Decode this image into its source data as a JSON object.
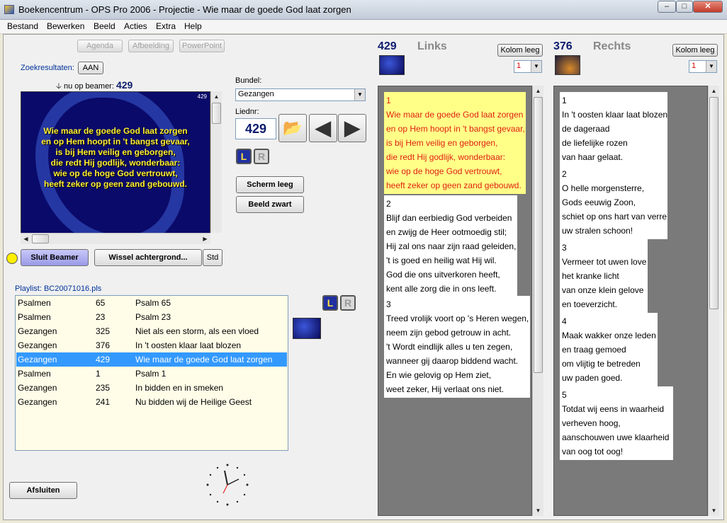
{
  "window": {
    "title": "Boekencentrum - OPS Pro 2006 - Projectie - Wie maar de goede God laat zorgen"
  },
  "menu": [
    "Bestand",
    "Bewerken",
    "Beeld",
    "Acties",
    "Extra",
    "Help"
  ],
  "toolbar": {
    "agenda": "Agenda",
    "afbeelding": "Afbeelding",
    "powerpoint": "PowerPoint"
  },
  "search": {
    "label": "Zoekresultaten:",
    "toggle": "AAN"
  },
  "beamer": {
    "label": "nu op beamer:",
    "current": "429",
    "corner_number": "429",
    "text": [
      "Wie maar de goede God laat zorgen",
      "en op Hem hoopt in 't bangst gevaar,",
      "is bij Hem veilig en geborgen,",
      "die redt Hij godlijk, wonderbaar:",
      "wie op de hoge God vertrouwt,",
      "heeft zeker op geen zand gebouwd."
    ]
  },
  "bundle": {
    "label": "Bundel:",
    "value": "Gezangen"
  },
  "song": {
    "label": "Liednr:",
    "value": "429"
  },
  "screen_buttons": {
    "clear": "Scherm leeg",
    "black": "Beeld zwart"
  },
  "beamer_controls": {
    "close": "Sluit Beamer",
    "background": "Wissel achtergrond...",
    "std": "Std"
  },
  "lr": {
    "left": "L",
    "right": "R"
  },
  "playlist": {
    "label": "Playlist: BC20071016.pls",
    "rows": [
      {
        "book": "Psalmen",
        "num": "65",
        "title": "Psalm 65"
      },
      {
        "book": "Psalmen",
        "num": "23",
        "title": "Psalm 23"
      },
      {
        "book": "Gezangen",
        "num": "325",
        "title": "Niet als een storm, als een vloed"
      },
      {
        "book": "Gezangen",
        "num": "376",
        "title": "In 't oosten klaar laat blozen"
      },
      {
        "book": "Gezangen",
        "num": "429",
        "title": "Wie maar de goede God laat zorgen"
      },
      {
        "book": "Psalmen",
        "num": "1",
        "title": "Psalm 1"
      },
      {
        "book": "Gezangen",
        "num": "235",
        "title": "In bidden en in smeken"
      },
      {
        "book": "Gezangen",
        "num": "241",
        "title": "Nu bidden wij de Heilige Geest"
      }
    ],
    "selected_index": 4
  },
  "exit": "Afsluiten",
  "left_panel": {
    "number": "429",
    "title": "Links",
    "clear": "Kolom leeg",
    "select_value": "1",
    "verses": [
      {
        "n": "1",
        "lines": [
          "Wie maar de goede God laat zorgen",
          "en op Hem hoopt in 't bangst gevaar,",
          "is bij Hem veilig en geborgen,",
          "die redt Hij godlijk, wonderbaar:",
          "wie op de hoge God vertrouwt,",
          "heeft zeker op geen zand gebouwd."
        ]
      },
      {
        "n": "2",
        "lines": [
          "Blijf dan eerbiedig God verbeiden",
          "en zwijg de Heer ootmoedig stil;",
          "Hij zal ons naar zijn raad geleiden,",
          "'t is goed en heilig wat Hij wil.",
          "God die ons uitverkoren heeft,",
          "kent alle zorg die in ons leeft."
        ]
      },
      {
        "n": "3",
        "lines": [
          "Treed vrolijk voort op 's Heren wegen,",
          "neem zijn gebod getrouw in acht.",
          "'t Wordt eindlijk alles u ten zegen,",
          "wanneer gij daarop biddend wacht.",
          "En wie gelovig op Hem ziet,",
          "weet zeker, Hij verlaat ons niet."
        ]
      }
    ]
  },
  "right_panel": {
    "number": "376",
    "title": "Rechts",
    "clear": "Kolom leeg",
    "select_value": "1",
    "verses": [
      {
        "n": "1",
        "lines": [
          "In 't oosten klaar laat blozen",
          "de dageraad",
          "de liefelijke rozen",
          "van haar gelaat."
        ]
      },
      {
        "n": "2",
        "lines": [
          "O helle morgensterre,",
          "Gods eeuwig Zoon,",
          "schiet op ons hart van verre",
          "uw stralen schoon!"
        ]
      },
      {
        "n": "3",
        "lines": [
          "Vermeer tot uwen love",
          "het kranke licht",
          "van onze klein gelove",
          "en toeverzicht."
        ]
      },
      {
        "n": "4",
        "lines": [
          "Maak wakker onze leden",
          "en traag gemoed",
          "om vlijtig te betreden",
          "uw paden goed."
        ]
      },
      {
        "n": "5",
        "lines": [
          "Totdat wij eens in waarheid",
          "verheven hoog,",
          "aanschouwen uwe klaarheid",
          "van oog tot oog!"
        ]
      }
    ]
  },
  "colors": {
    "highlight": "#ffff88",
    "verse_red": "#e02010",
    "selection": "#3399ff",
    "number_blue": "#0c1c6c"
  }
}
